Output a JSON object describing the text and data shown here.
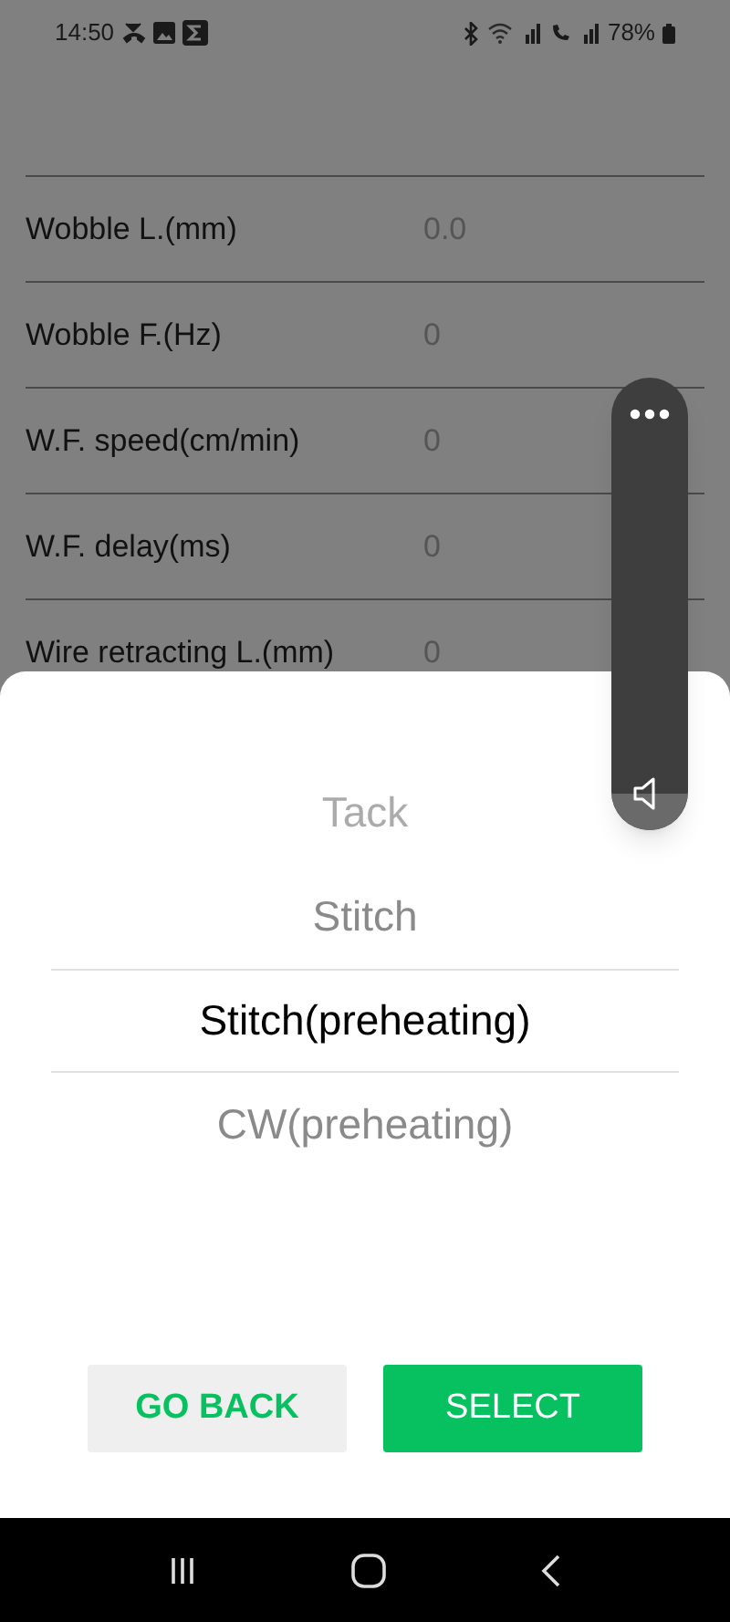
{
  "status_bar": {
    "time": "14:50",
    "battery": "78%"
  },
  "settings": [
    {
      "label": "Wobble L.(mm)",
      "value": "0.0"
    },
    {
      "label": "Wobble F.(Hz)",
      "value": "0"
    },
    {
      "label": "W.F. speed(cm/min)",
      "value": "0"
    },
    {
      "label": "W.F. delay(ms)",
      "value": "0"
    },
    {
      "label": "Wire retracting L.(mm)",
      "value": "0"
    }
  ],
  "picker": {
    "options": [
      {
        "label": "Tack",
        "selected": false
      },
      {
        "label": "Stitch",
        "selected": false
      },
      {
        "label": "Stitch(preheating)",
        "selected": true
      },
      {
        "label": "CW(preheating)",
        "selected": false
      }
    ]
  },
  "buttons": {
    "back": "GO BACK",
    "select": "SELECT"
  },
  "volume": {
    "level": 0.08
  }
}
